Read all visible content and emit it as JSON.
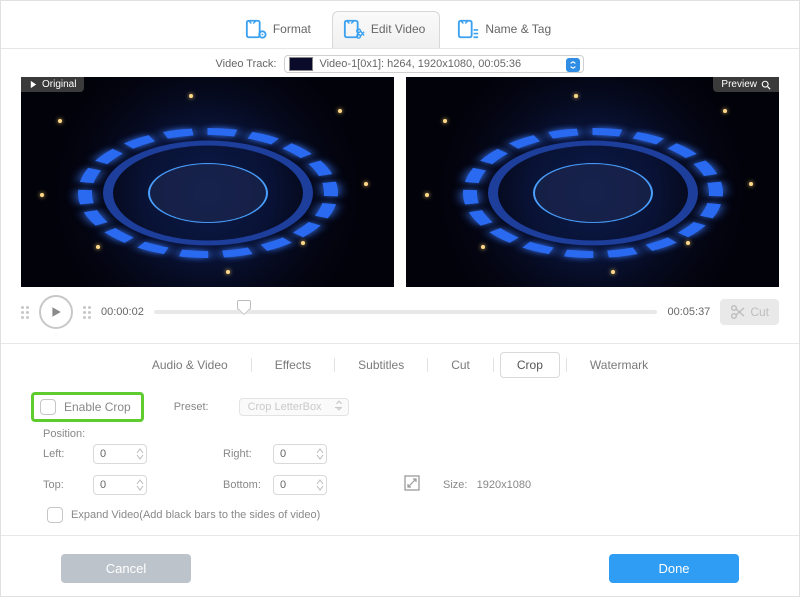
{
  "top_tabs": {
    "format": "Format",
    "edit_video": "Edit Video",
    "name_tag": "Name & Tag"
  },
  "track": {
    "label": "Video Track:",
    "value": "Video-1[0x1]: h264, 1920x1080, 00:05:36"
  },
  "badges": {
    "original": "Original",
    "preview": "Preview"
  },
  "playback": {
    "current": "00:00:02",
    "total": "00:05:37",
    "cut_label": "Cut"
  },
  "sub_tabs": {
    "audio_video": "Audio & Video",
    "effects": "Effects",
    "subtitles": "Subtitles",
    "cut": "Cut",
    "crop": "Crop",
    "watermark": "Watermark"
  },
  "crop": {
    "enable_label": "Enable Crop",
    "preset_label": "Preset:",
    "preset_value": "Crop LetterBox",
    "position_label": "Position:",
    "left_label": "Left:",
    "right_label": "Right:",
    "top_label": "Top:",
    "bottom_label": "Bottom:",
    "left": "0",
    "right": "0",
    "top": "0",
    "bottom": "0",
    "size_label": "Size:",
    "size_value": "1920x1080",
    "expand_label": "Expand Video(Add black bars to the sides of video)"
  },
  "footer": {
    "cancel": "Cancel",
    "done": "Done"
  }
}
